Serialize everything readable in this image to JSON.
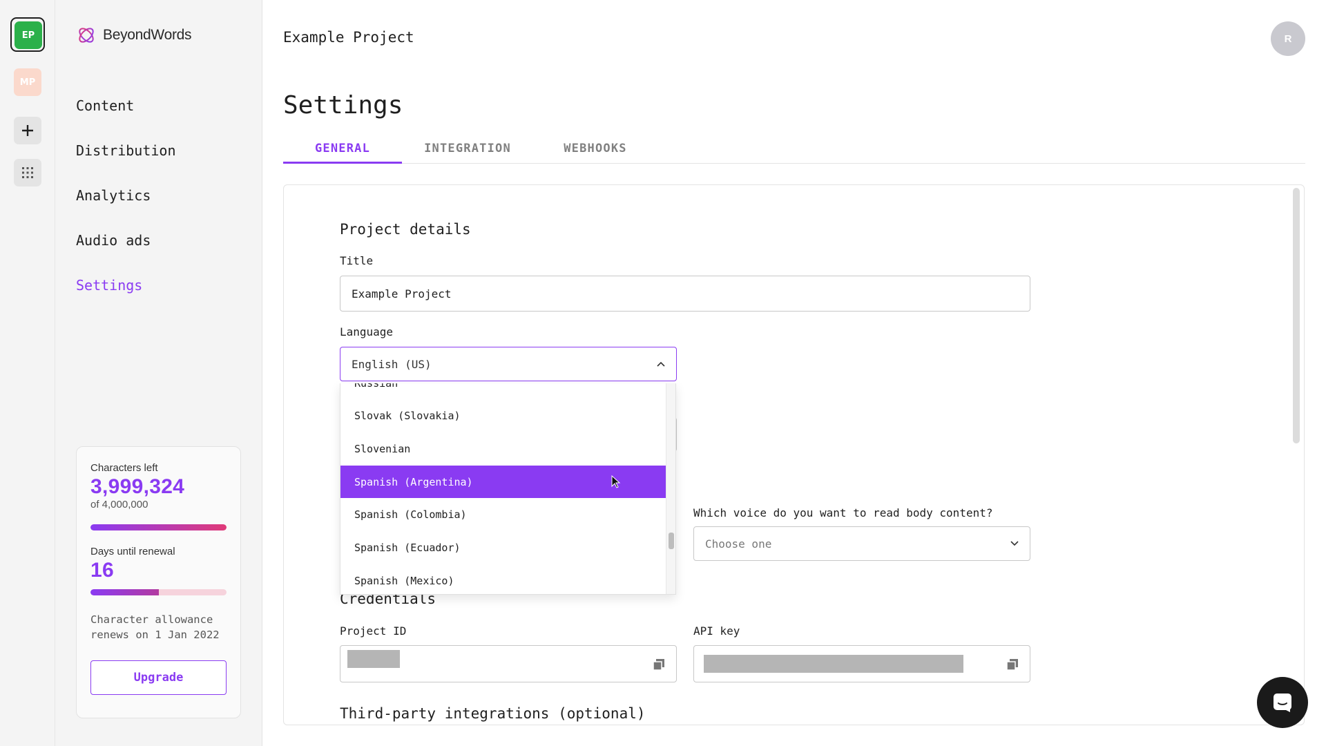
{
  "rail": {
    "projects": [
      {
        "initials": "EP",
        "color": "#2bb04a",
        "active": true
      },
      {
        "initials": "MP",
        "color": "#fbd9cc",
        "active": false
      }
    ],
    "add_icon": "plus-icon",
    "apps_icon": "grid-dots-icon"
  },
  "brand": {
    "name": "BeyondWords",
    "logo_icon": "beyondwords-logo-icon"
  },
  "nav": {
    "items": [
      {
        "label": "Content",
        "active": false
      },
      {
        "label": "Distribution",
        "active": false
      },
      {
        "label": "Analytics",
        "active": false
      },
      {
        "label": "Audio ads",
        "active": false
      },
      {
        "label": "Settings",
        "active": true
      }
    ]
  },
  "usage": {
    "chars_label": "Characters left",
    "chars_left": "3,999,324",
    "chars_total": "of 4,000,000",
    "chars_progress": 0.9998,
    "days_label": "Days until renewal",
    "days_left": "16",
    "days_progress": 0.5,
    "renew_text": "Character allowance renews on 1 Jan 2022",
    "upgrade_label": "Upgrade"
  },
  "header": {
    "project_title": "Example Project",
    "avatar_initial": "R"
  },
  "page": {
    "title": "Settings",
    "tabs": [
      {
        "label": "GENERAL",
        "active": true
      },
      {
        "label": "INTEGRATION",
        "active": false
      },
      {
        "label": "WEBHOOKS",
        "active": false
      }
    ]
  },
  "project_details": {
    "heading": "Project details",
    "title_label": "Title",
    "title_value": "Example Project",
    "language_label": "Language",
    "language_value": "English (US)",
    "body_voice_label": "Which voice do you want to read body content?",
    "body_voice_placeholder": "Choose one"
  },
  "language_dropdown": {
    "options": [
      {
        "label": "Russian",
        "highlighted": false
      },
      {
        "label": "Slovak (Slovakia)",
        "highlighted": false
      },
      {
        "label": "Slovenian",
        "highlighted": false
      },
      {
        "label": "Spanish (Argentina)",
        "highlighted": true
      },
      {
        "label": "Spanish (Colombia)",
        "highlighted": false
      },
      {
        "label": "Spanish (Ecuador)",
        "highlighted": false
      },
      {
        "label": "Spanish (Mexico)",
        "highlighted": false
      }
    ]
  },
  "credentials": {
    "heading": "Credentials",
    "project_id_label": "Project ID",
    "api_key_label": "API key",
    "copy_icon": "copy-icon"
  },
  "third_party": {
    "heading": "Third-party integrations (optional)"
  },
  "colors": {
    "accent": "#8a3bf2",
    "pink": "#e03a78",
    "project_green": "#2bb04a"
  },
  "chat_icon": "chat-icon"
}
